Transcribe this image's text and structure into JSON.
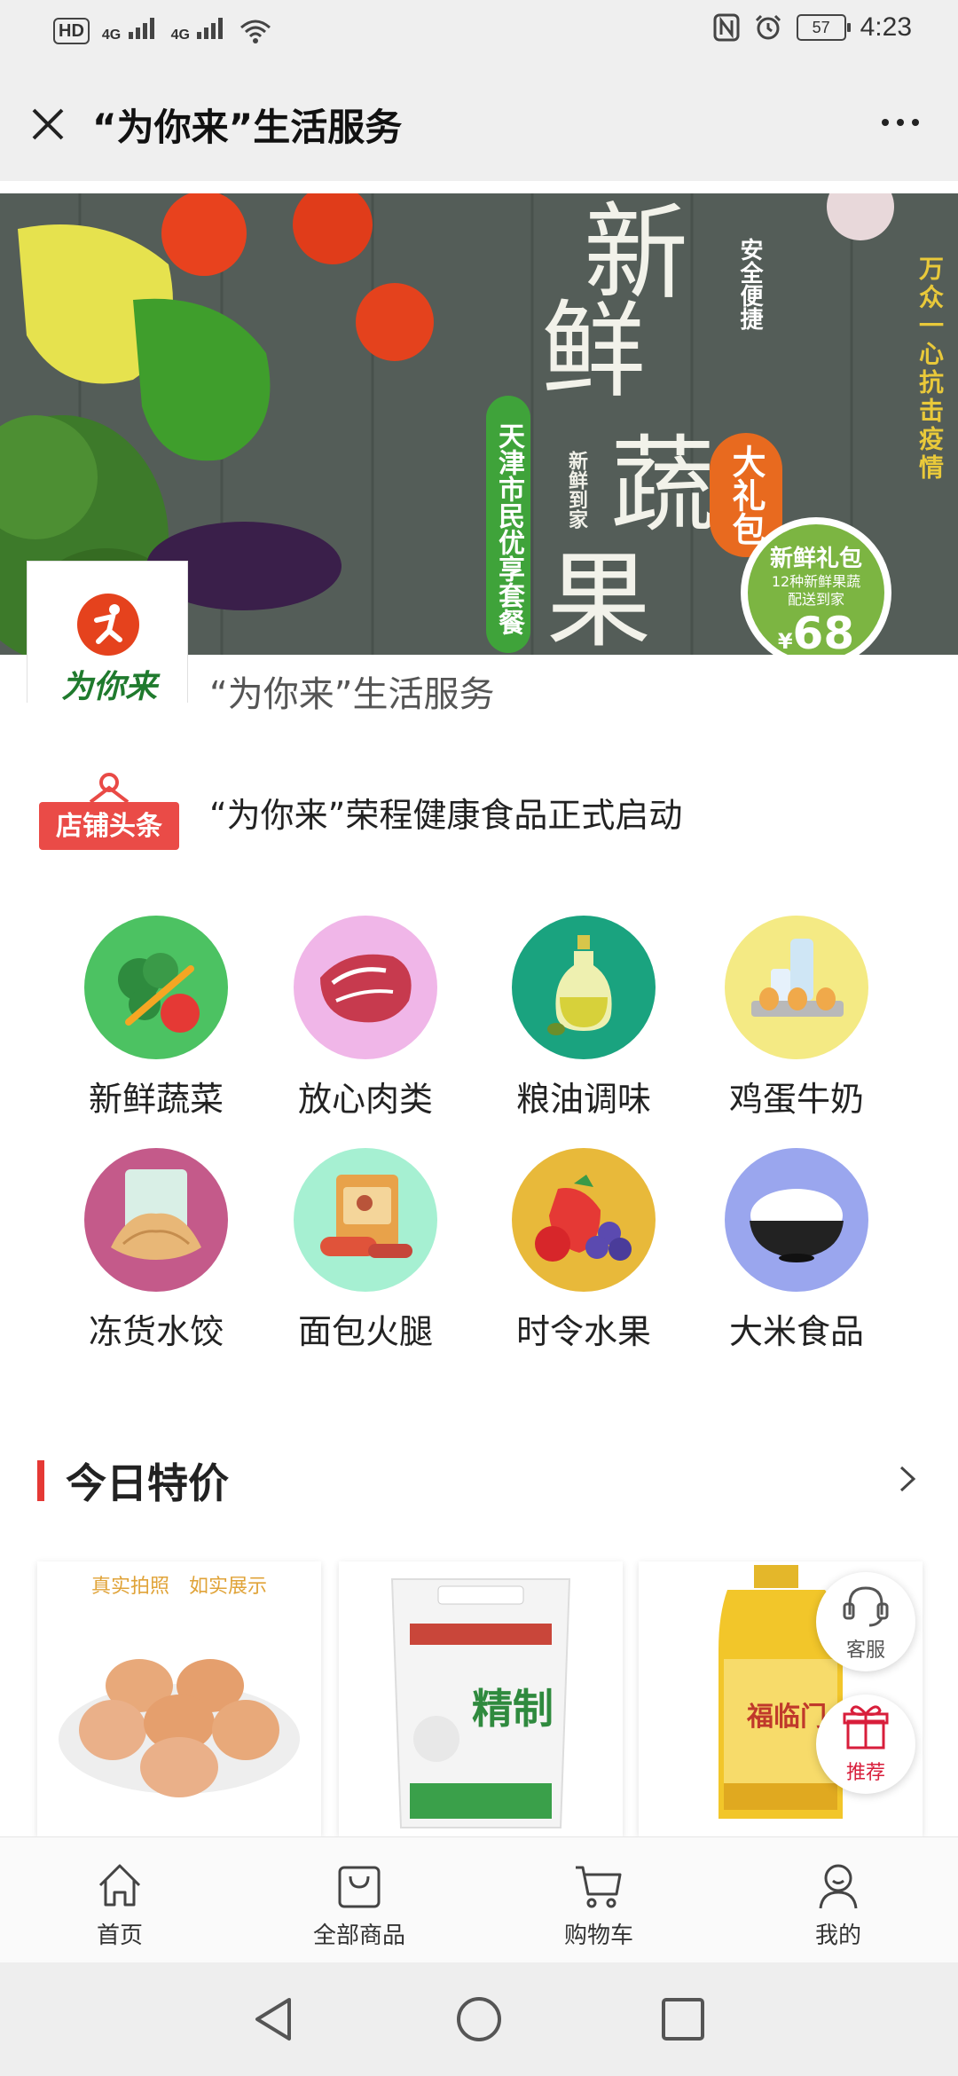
{
  "status_bar": {
    "hd_label": "HD",
    "net1": "4G",
    "net2": "4G",
    "battery": "57",
    "time": "4:23"
  },
  "title_bar": {
    "title": "“为你来”生活服务"
  },
  "banner": {
    "big_chars": [
      "新",
      "鲜",
      "蔬",
      "果"
    ],
    "tag_left": "天津市民优享套餐",
    "tag_mid": "新鲜到家",
    "tag_safe": "安全便捷",
    "tag_package": "大礼包",
    "tag_right": "万众一心抗击疫情",
    "gift_title": "新鲜礼包",
    "gift_sub1": "12种新鲜果蔬",
    "gift_sub2": "配送到家",
    "gift_price": "68",
    "gift_currency": "¥"
  },
  "store": {
    "logo_text": "为你来",
    "name": "“为你来”生活服务"
  },
  "headline": {
    "badge": "店铺头条",
    "text": "“为你来”荣程健康食品正式启动"
  },
  "categories": [
    {
      "label": "新鲜蔬菜",
      "bg": "#4cc262"
    },
    {
      "label": "放心肉类",
      "bg": "#f0b6e8"
    },
    {
      "label": "粮油调味",
      "bg": "#1aa37f"
    },
    {
      "label": "鸡蛋牛奶",
      "bg": "#f4ea84"
    },
    {
      "label": "冻货水饺",
      "bg": "#c45a8a"
    },
    {
      "label": "面包火腿",
      "bg": "#a6f0d2"
    },
    {
      "label": "时令水果",
      "bg": "#e8b93a"
    },
    {
      "label": "大米食品",
      "bg": "#9aa6ee"
    }
  ],
  "section": {
    "title": "今日特价"
  },
  "products": {
    "eggs_caption": "真实拍照　如实展示",
    "flour_label": "精制",
    "oil_label": "福临门"
  },
  "float_buttons": {
    "service": "客服",
    "recommend": "推荐"
  },
  "bottom_nav": [
    {
      "label": "首页"
    },
    {
      "label": "全部商品"
    },
    {
      "label": "购物车"
    },
    {
      "label": "我的"
    }
  ]
}
